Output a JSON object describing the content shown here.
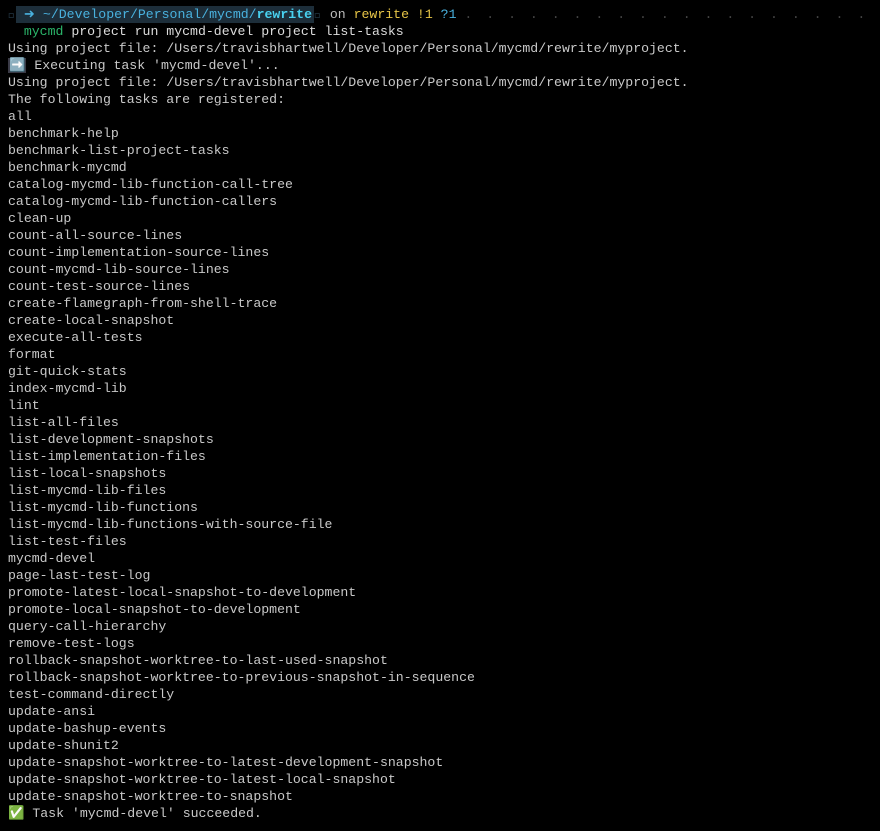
{
  "prompt": {
    "apple_glyph": "",
    "arrow_glyph": "➜",
    "tilde": "~",
    "path_prefix": "/Developer/Personal/mycmd/",
    "path_leaf": "rewrite",
    "on_word": "on",
    "git_glyph": "",
    "branch_glyph": "",
    "branch_name": "rewrite",
    "flag1": "!1",
    "flag2": "?1"
  },
  "command": {
    "program": "mycmd",
    "args": "project run mycmd-devel project list-tasks"
  },
  "output": {
    "using1": "Using project file: /Users/travisbhartwell/Developer/Personal/mycmd/rewrite/myproject.",
    "exec_glyph": "➡️",
    "exec_text": "Executing task 'mycmd-devel'...",
    "using2": "Using project file: /Users/travisbhartwell/Developer/Personal/mycmd/rewrite/myproject.",
    "registered": "The following tasks are registered:",
    "tasks": [
      "all",
      "benchmark-help",
      "benchmark-list-project-tasks",
      "benchmark-mycmd",
      "catalog-mycmd-lib-function-call-tree",
      "catalog-mycmd-lib-function-callers",
      "clean-up",
      "count-all-source-lines",
      "count-implementation-source-lines",
      "count-mycmd-lib-source-lines",
      "count-test-source-lines",
      "create-flamegraph-from-shell-trace",
      "create-local-snapshot",
      "execute-all-tests",
      "format",
      "git-quick-stats",
      "index-mycmd-lib",
      "lint",
      "list-all-files",
      "list-development-snapshots",
      "list-implementation-files",
      "list-local-snapshots",
      "list-mycmd-lib-files",
      "list-mycmd-lib-functions",
      "list-mycmd-lib-functions-with-source-file",
      "list-test-files",
      "mycmd-devel",
      "page-last-test-log",
      "promote-latest-local-snapshot-to-development",
      "promote-local-snapshot-to-development",
      "query-call-hierarchy",
      "remove-test-logs",
      "rollback-snapshot-worktree-to-last-used-snapshot",
      "rollback-snapshot-worktree-to-previous-snapshot-in-sequence",
      "test-command-directly",
      "update-ansi",
      "update-bashup-events",
      "update-shunit2",
      "update-snapshot-worktree-to-latest-development-snapshot",
      "update-snapshot-worktree-to-latest-local-snapshot",
      "update-snapshot-worktree-to-snapshot"
    ],
    "done_glyph": "✅",
    "done_text": "Task 'mycmd-devel' succeeded."
  },
  "fill_dots": ". . . . . . . . . . . . . . . . . . . . . . . . . . . . . . . . . . . . . . . . . . . . . . . . . . . . . . . . . . . . . . . . . . . . ."
}
